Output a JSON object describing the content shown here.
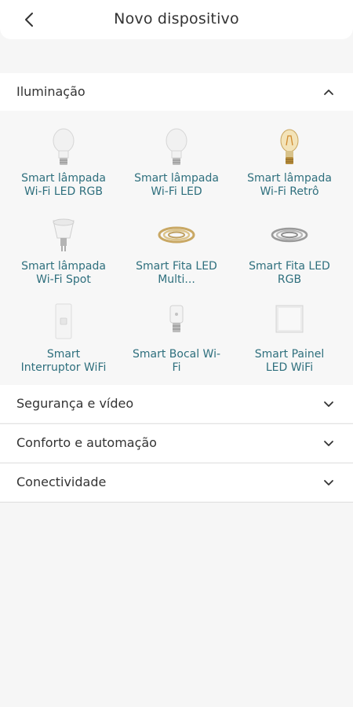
{
  "header": {
    "title": "Novo dispositivo",
    "back_icon": "chevron-left-icon"
  },
  "categories": [
    {
      "label": "Iluminação",
      "expanded": true
    },
    {
      "label": "Segurança e vídeo",
      "expanded": false
    },
    {
      "label": "Conforto e automação",
      "expanded": false
    },
    {
      "label": "Conectividade",
      "expanded": false
    }
  ],
  "devices": [
    {
      "line1": "Smart lâmpada",
      "line2": "Wi-Fi LED RGB",
      "icon": "bulb-icon"
    },
    {
      "line1": "Smart lâmpada",
      "line2": "Wi-Fi LED",
      "icon": "bulb-icon"
    },
    {
      "line1": "Smart lâmpada",
      "line2": "Wi-Fi Retrô",
      "icon": "retro-bulb-icon"
    },
    {
      "line1": "Smart lâmpada",
      "line2": "Wi-Fi Spot",
      "icon": "spot-bulb-icon"
    },
    {
      "line1": "Smart Fita LED",
      "line2": "Multi...",
      "icon": "led-strip-icon"
    },
    {
      "line1": "Smart Fita LED",
      "line2": "RGB",
      "icon": "led-strip-icon"
    },
    {
      "line1": "Smart",
      "line2": "Interruptor WiFi",
      "icon": "wall-switch-icon"
    },
    {
      "line1": "Smart Bocal Wi-",
      "line2": "Fi",
      "icon": "bulb-socket-icon"
    },
    {
      "line1": "Smart Painel",
      "line2": "LED WiFi",
      "icon": "led-panel-icon"
    }
  ],
  "colors": {
    "device_text": "#2e6f7d",
    "background": "#f6f6f6",
    "card": "#ffffff"
  }
}
